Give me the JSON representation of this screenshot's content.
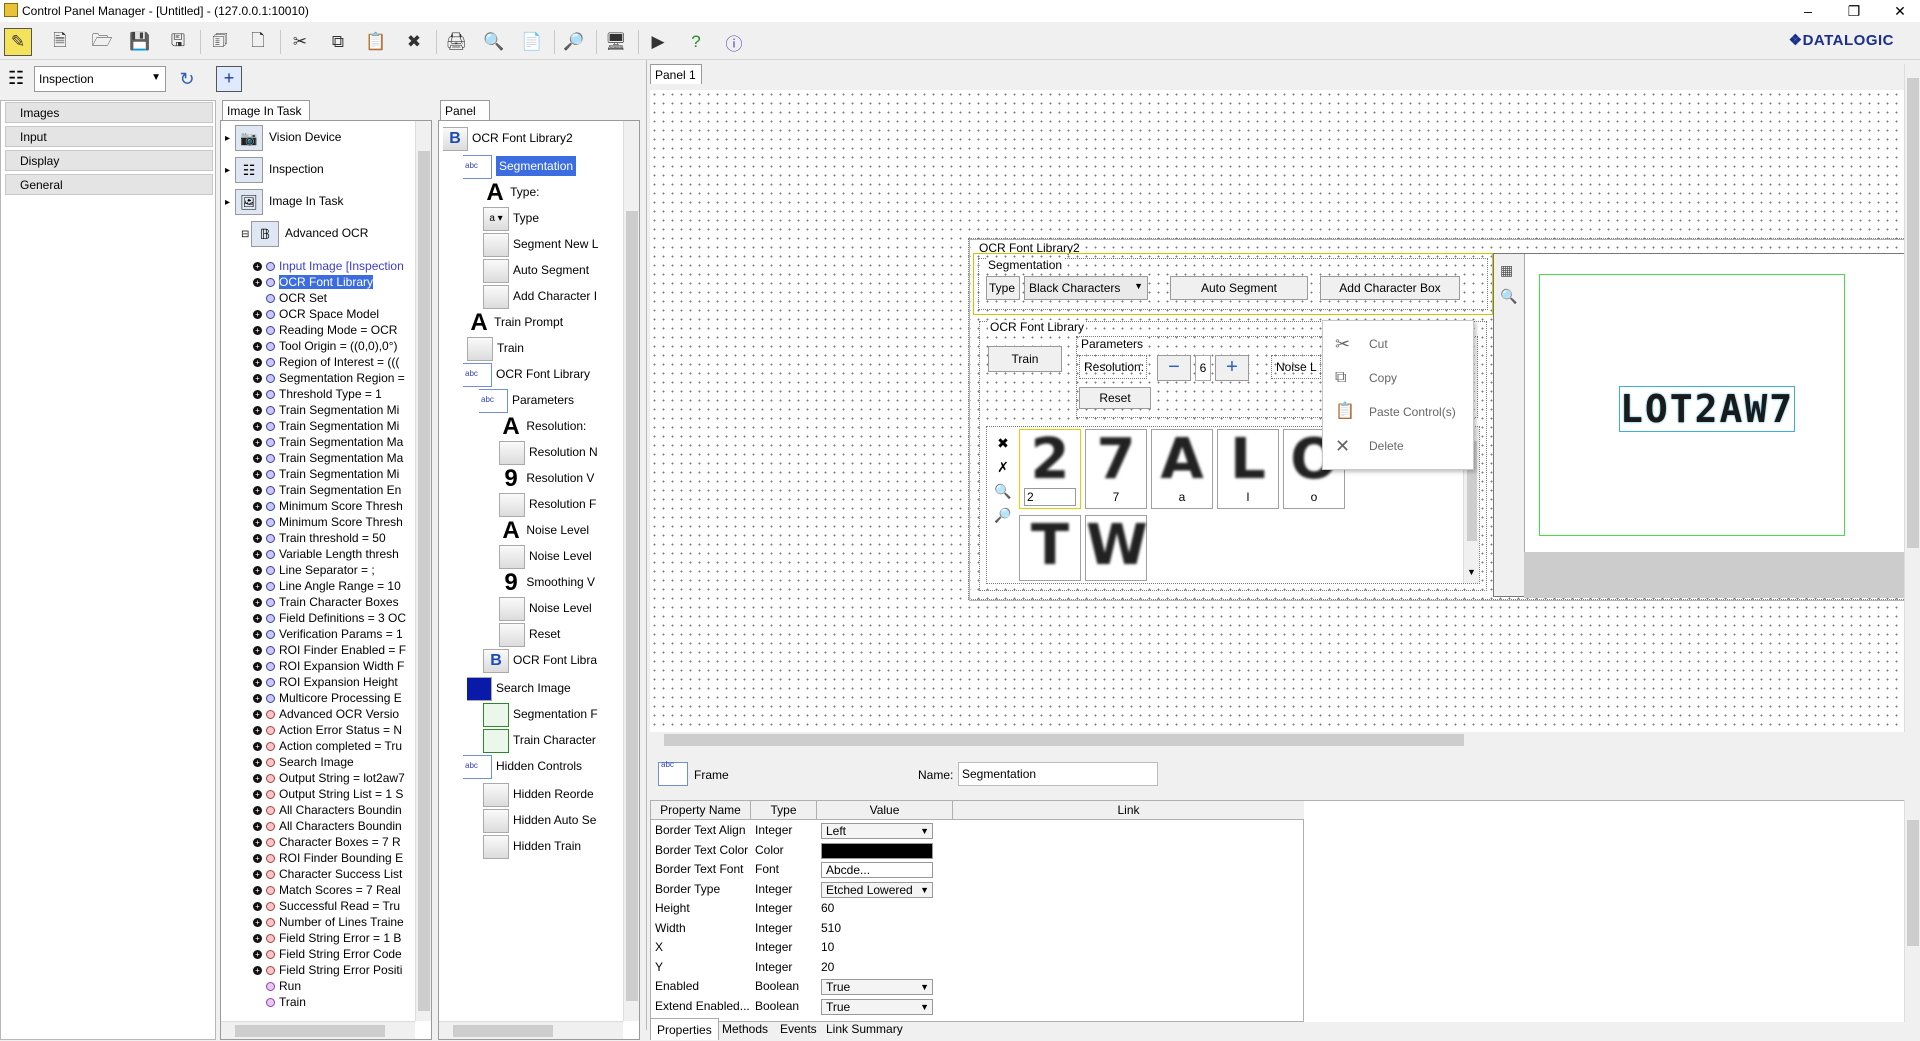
{
  "window": {
    "title": "Control Panel Manager - [Untitled] - (127.0.0.1:10010)",
    "brand": "DATALOGIC"
  },
  "toolbar": {
    "icons": [
      "select-mode-icon",
      "new-file-icon",
      "open-folder-icon",
      "save-icon",
      "save-all-icon",
      "import-icon",
      "export-icon",
      "cut-icon",
      "copy-icon",
      "paste-icon",
      "delete-icon",
      "print-icon",
      "print-preview-icon",
      "page-setup-icon",
      "zoom-icon",
      "monitor-icon",
      "run-icon",
      "help-icon",
      "about-icon"
    ]
  },
  "inspection_select": {
    "value": "Inspection"
  },
  "sidebar": {
    "items": [
      "Images",
      "Input",
      "Display",
      "General"
    ]
  },
  "image_in_task": {
    "tab": "Image In Task",
    "top_nodes": [
      "Vision Device",
      "Inspection",
      "Image In Task",
      "Advanced OCR"
    ],
    "children": [
      "Input Image [Inspection",
      "OCR Font Library",
      "OCR Set",
      "OCR Space Model",
      "Reading Mode = OCR",
      "Tool Origin = ((0,0),0°)",
      "Region of Interest = (((",
      "Segmentation Region =",
      "Threshold Type = 1",
      "Train Segmentation Mi",
      "Train Segmentation Mi",
      "Train Segmentation Ma",
      "Train Segmentation Ma",
      "Train Segmentation Mi",
      "Train Segmentation En",
      "Minimum Score Thresh",
      "Minimum Score Thresh",
      "Train threshold = 50",
      "Variable Length thresh",
      "Line Separator = ;",
      "Line Angle Range = 10",
      "Train Character Boxes",
      "Field Definitions = 3 OC",
      "Verification Params = 1",
      "ROI Finder Enabled = F",
      "ROI Expansion Width F",
      "ROI Expansion Height",
      "Multicore Processing E",
      "Advanced OCR Versio",
      "Action Error Status = N",
      "Action completed = Tru",
      "Search Image",
      "Output String = lot2aw7",
      "Output String List = 1 S",
      "All Characters Boundin",
      "All Characters Boundin",
      "Character Boxes = 7 R",
      "ROI Finder Bounding E",
      "Character Success List",
      "Match Scores = 7 Real",
      "Successful Read = Tru",
      "Number of Lines Traine",
      "Field String Error = 1 B",
      "Field String Error Code",
      "Field String Error Positi",
      "Run",
      "Train"
    ]
  },
  "panel_tree": {
    "tab": "Panel 1",
    "nodes": [
      "OCR Font Library2",
      "Segmentation",
      "Type:",
      "Type",
      "Segment New L",
      "Auto Segment",
      "Add Character I",
      "Train Prompt",
      "Train",
      "OCR Font Library",
      "Parameters",
      "Resolution:",
      "Resolution N",
      "Resolution V",
      "Resolution F",
      "Noise Level",
      "Noise Level",
      "Smoothing V",
      "Noise Level",
      "Reset",
      "OCR Font Libra",
      "Search Image",
      "Segmentation F",
      "Train Character",
      "Hidden Controls",
      "Hidden Reorde",
      "Hidden Auto Se",
      "Hidden Train"
    ]
  },
  "designer": {
    "tab": "Panel 1",
    "frame_title": "OCR Font Library2",
    "segmentation": {
      "title": "Segmentation",
      "type_label": "Type",
      "type_value": "Black Characters",
      "auto_btn": "Auto Segment",
      "add_btn": "Add Character Box"
    },
    "library": {
      "title": "OCR Font Library",
      "train_btn": "Train",
      "params_title": "Parameters",
      "resolution_label": "Resolution:",
      "resolution_value": "6",
      "noise_label": "Noise L",
      "reset_btn": "Reset",
      "edit_value": "2"
    },
    "chars": [
      {
        "glyph": "2",
        "label": "2"
      },
      {
        "glyph": "7",
        "label": "7"
      },
      {
        "glyph": "A",
        "label": "a"
      },
      {
        "glyph": "L",
        "label": "l"
      },
      {
        "glyph": "O",
        "label": "o"
      },
      {
        "glyph": "T",
        "label": ""
      },
      {
        "glyph": "W",
        "label": ""
      }
    ],
    "ocr_result": "LOT2AW7",
    "context_menu": {
      "cut": "Cut",
      "copy": "Copy",
      "paste": "Paste Control(s)",
      "delete": "Delete"
    }
  },
  "inspector": {
    "frame_label": "Frame",
    "name_label": "Name:",
    "name_value": "Segmentation",
    "columns": [
      "Property Name",
      "Type",
      "Value",
      "Link"
    ],
    "rows": [
      {
        "name": "Border Text Align",
        "type": "Integer",
        "value": "Left",
        "kind": "combo"
      },
      {
        "name": "Border Text Color",
        "type": "Color",
        "value": "",
        "kind": "color"
      },
      {
        "name": "Border Text Font",
        "type": "Font",
        "value": "Abcde...",
        "kind": "text"
      },
      {
        "name": "Border Type",
        "type": "Integer",
        "value": "Etched Lowered",
        "kind": "combo"
      },
      {
        "name": "Height",
        "type": "Integer",
        "value": "60",
        "kind": "plain"
      },
      {
        "name": "Width",
        "type": "Integer",
        "value": "510",
        "kind": "plain"
      },
      {
        "name": "X",
        "type": "Integer",
        "value": "10",
        "kind": "plain"
      },
      {
        "name": "Y",
        "type": "Integer",
        "value": "20",
        "kind": "plain"
      },
      {
        "name": "Enabled",
        "type": "Boolean",
        "value": "True",
        "kind": "combo"
      },
      {
        "name": "Extend Enabled...",
        "type": "Boolean",
        "value": "True",
        "kind": "combo"
      }
    ],
    "tabs": [
      "Properties",
      "Methods",
      "Events",
      "Link Summary"
    ]
  }
}
